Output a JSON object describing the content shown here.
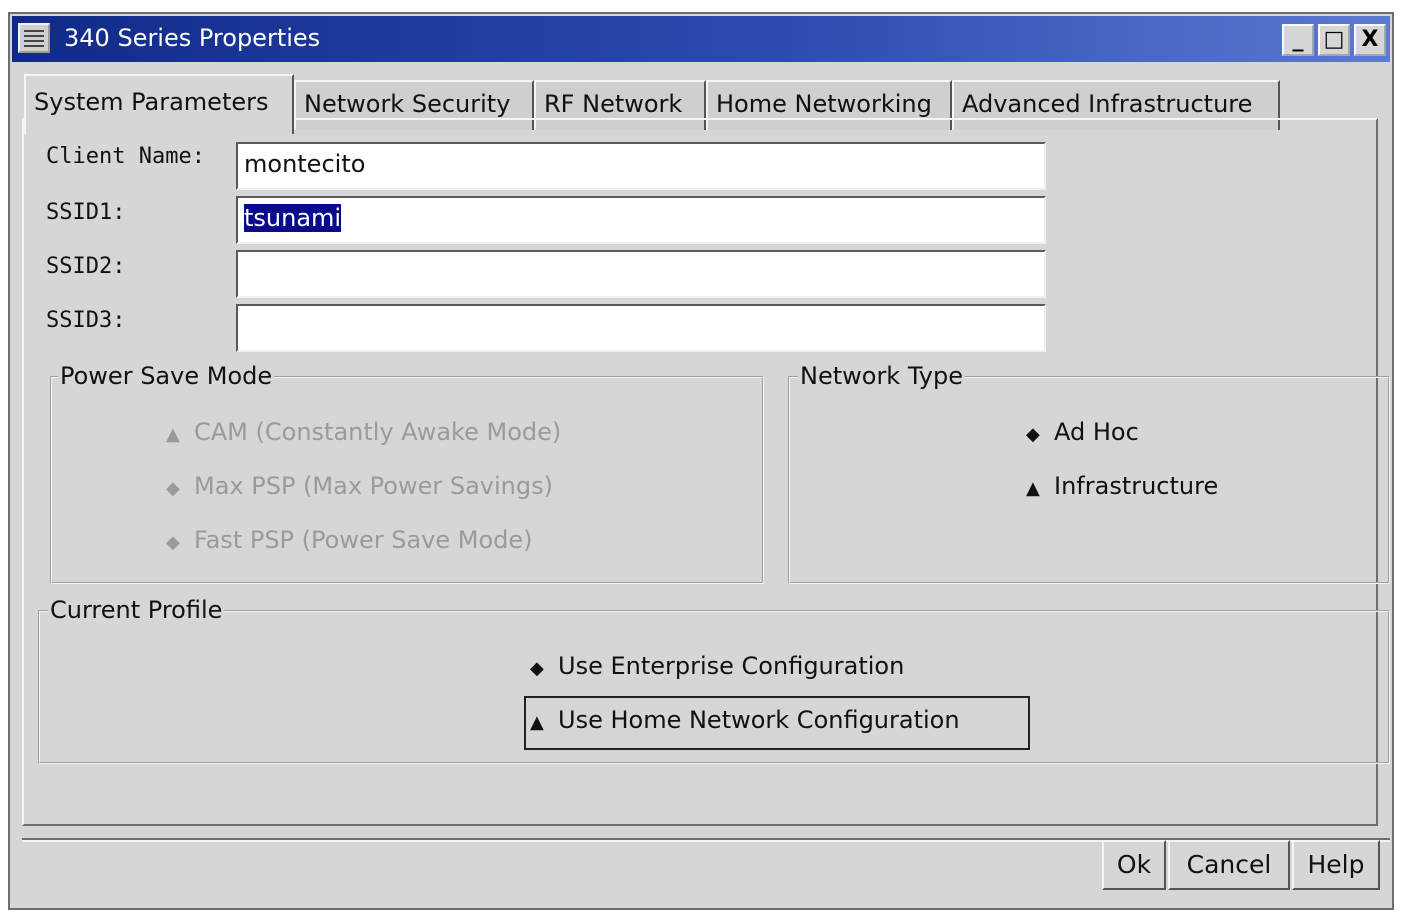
{
  "window": {
    "title": "340 Series Properties",
    "controls": {
      "minimize": "_",
      "maximize": "□",
      "close": "X"
    }
  },
  "tabs": [
    {
      "label": "System Parameters",
      "active": true
    },
    {
      "label": "Network Security",
      "active": false
    },
    {
      "label": "RF Network",
      "active": false
    },
    {
      "label": "Home Networking",
      "active": false
    },
    {
      "label": "Advanced Infrastructure",
      "active": false
    }
  ],
  "fields": {
    "client_name": {
      "label": "Client Name:",
      "value": "montecito"
    },
    "ssid1": {
      "label": "SSID1:",
      "value": "tsunami"
    },
    "ssid2": {
      "label": "SSID2:",
      "value": ""
    },
    "ssid3": {
      "label": "SSID3:",
      "value": ""
    }
  },
  "power_save": {
    "title": "Power Save Mode",
    "options": [
      {
        "label": "CAM (Constantly Awake Mode)",
        "selected": true,
        "enabled": false
      },
      {
        "label": "Max PSP (Max Power Savings)",
        "selected": false,
        "enabled": false
      },
      {
        "label": "Fast PSP (Power Save Mode)",
        "selected": false,
        "enabled": false
      }
    ]
  },
  "network_type": {
    "title": "Network Type",
    "options": [
      {
        "label": "Ad Hoc",
        "selected": false
      },
      {
        "label": "Infrastructure",
        "selected": true
      }
    ]
  },
  "current_profile": {
    "title": "Current Profile",
    "options": [
      {
        "label": "Use Enterprise Configuration",
        "selected": false
      },
      {
        "label": "Use Home Network Configuration",
        "selected": true
      }
    ]
  },
  "buttons": {
    "ok": "Ok",
    "cancel": "Cancel",
    "help": "Help"
  },
  "colors": {
    "titlebar": "#102a88",
    "selection": "#0a0a8c",
    "window_bg": "#d6d6d6"
  }
}
